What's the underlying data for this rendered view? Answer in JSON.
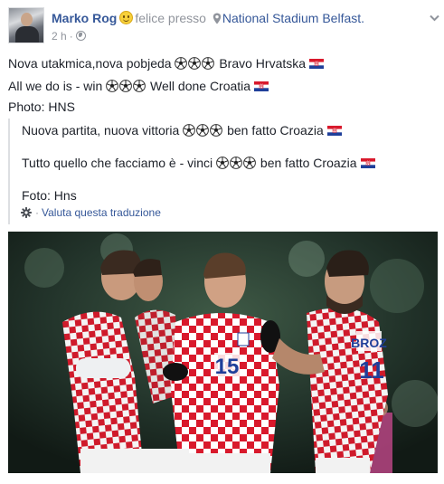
{
  "post": {
    "author": "Marko Rog",
    "feeling": "felice presso",
    "location": "National Stadium Belfast.",
    "time": "2 h",
    "dot": "·"
  },
  "body": {
    "line1_text": "Nova utakmica,nova pobjeda",
    "line1_tail": "Bravo Hrvatska",
    "line2_text": "All we do is - win",
    "line2_tail": "Well done Croatia",
    "line3": "Photo: HNS"
  },
  "translation": {
    "line1_text": "Nuova partita, nuova vittoria",
    "line1_tail": "ben fatto Croazia",
    "line2_text": "Tutto quello che facciamo è - vinci",
    "line2_tail": "ben fatto Croazia",
    "line3": "Foto: Hns",
    "rate_dot": "·",
    "rate_label": "Valuta questa traduzione"
  },
  "photo": {
    "jersey_numbers": [
      "15",
      "11"
    ],
    "back_name": "BROZ"
  },
  "colors": {
    "link": "#365899",
    "muted": "#90949c",
    "text": "#1d2129",
    "croatia_red": "#d9192c"
  },
  "icons": [
    "smiley-icon",
    "map-pin-icon",
    "globe-icon",
    "chevron-down-icon",
    "soccer-ball-icon",
    "croatia-flag-icon",
    "gear-icon"
  ]
}
